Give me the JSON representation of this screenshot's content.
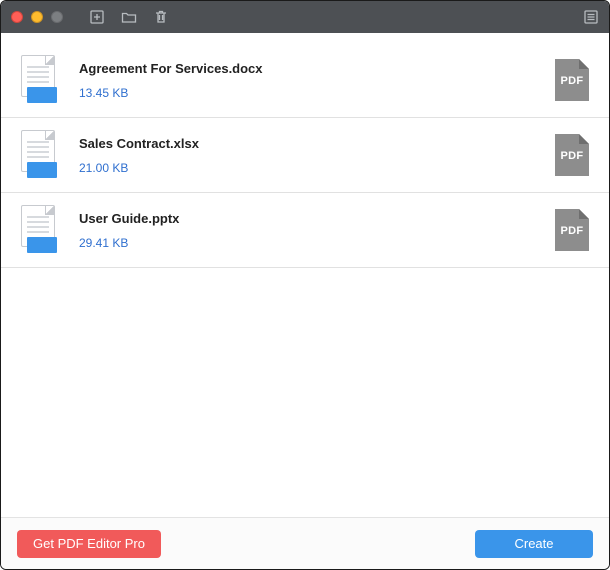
{
  "toolbar": {
    "add_icon": "add-file-icon",
    "folder_icon": "folder-icon",
    "trash_icon": "trash-icon",
    "list_icon": "list-icon"
  },
  "files": [
    {
      "name": "Agreement For Services.docx",
      "size": "13.45 KB",
      "target": "PDF"
    },
    {
      "name": "Sales Contract.xlsx",
      "size": "21.00 KB",
      "target": "PDF"
    },
    {
      "name": "User Guide.pptx",
      "size": "29.41 KB",
      "target": "PDF"
    }
  ],
  "footer": {
    "pro_label": "Get PDF Editor Pro",
    "create_label": "Create"
  }
}
